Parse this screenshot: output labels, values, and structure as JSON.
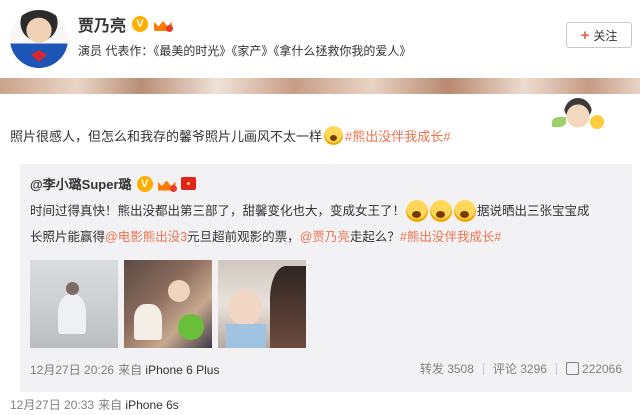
{
  "profile": {
    "name": "贾乃亮",
    "bio_prefix": "演员 代表作：",
    "works": [
      "《最美的时光》",
      "《家产》",
      "《拿什么拯救你我的爱人》"
    ],
    "follow_label": "关注",
    "follow_icon": "+"
  },
  "post": {
    "text": "照片很感人，但怎么和我存的馨爷照片儿画风不太一样",
    "topic": "#熊出没伴我成长#",
    "time": "12月27日 20:33",
    "source_prefix": "来自",
    "source": "iPhone 6s"
  },
  "repost": {
    "author": "@李小璐Super璐",
    "line1_a": "时间过得真快！熊出没都出第三部了，甜馨变化也大，变成女王了！",
    "line1_b": "据说晒出三张宝宝成",
    "line2_a": "长照片能赢得",
    "line2_link1": "@电影熊出没3",
    "line2_b": " 元旦超前观影的票，",
    "line2_link2": "@贾乃亮",
    "line2_c": " 走起么？",
    "line2_topic": "#熊出没伴我成长#",
    "time": "12月27日 20:26",
    "source_prefix": "来自",
    "source": "iPhone 6 Plus",
    "repost_label": "转发",
    "repost_count": "3508",
    "comment_label": "评论",
    "comment_count": "3296",
    "like_count": "222066"
  },
  "colors": {
    "link": "#eb7350",
    "badge": "#ffae00",
    "repost_bg": "#f2f2f5"
  }
}
